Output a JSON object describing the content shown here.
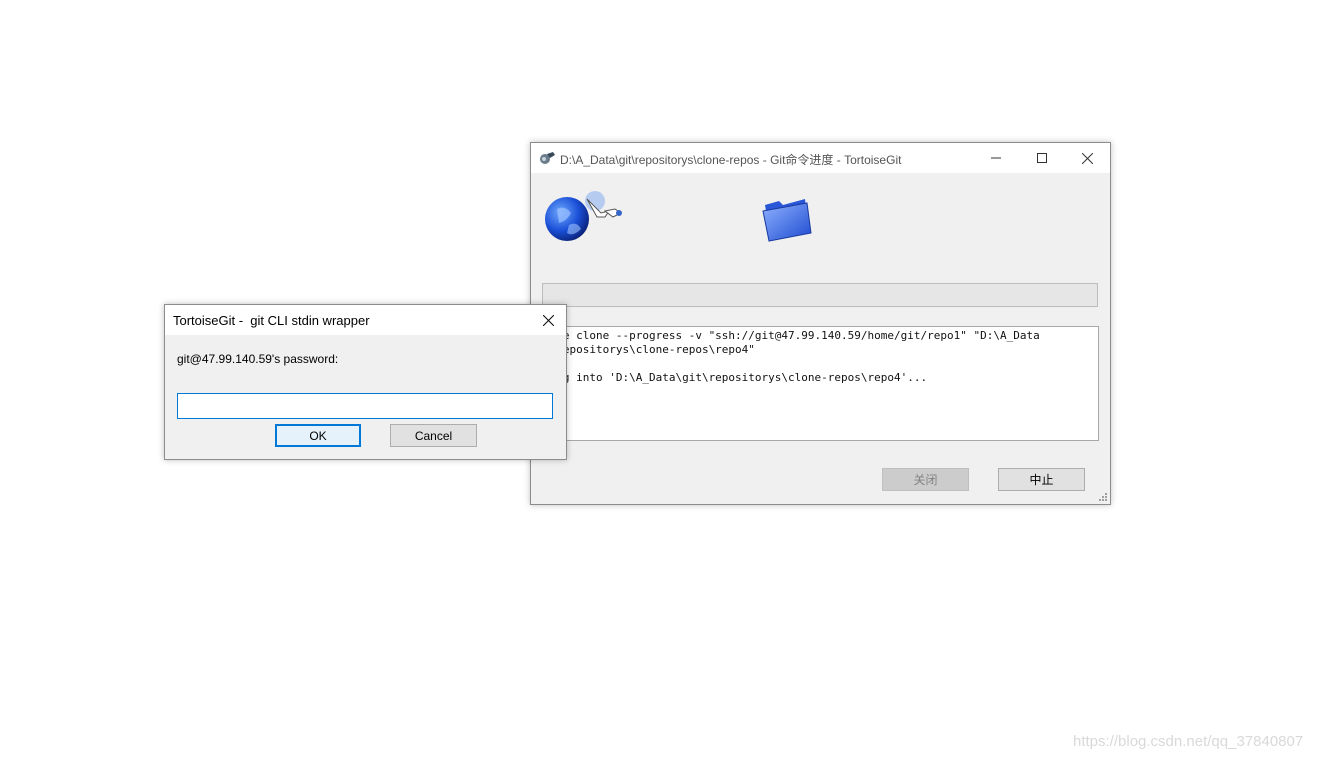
{
  "progress_window": {
    "title": "D:\\A_Data\\git\\repositorys\\clone-repos - Git命令进度 - TortoiseGit",
    "console_lines": [
      ".exe clone --progress -v \"ssh://git@47.99.140.59/home/git/repo1\" \"D:\\A_Data",
      "t\\repositorys\\clone-repos\\repo4\"",
      "",
      "ning into 'D:\\A_Data\\git\\repositorys\\clone-repos\\repo4'..."
    ],
    "close_label": "关闭",
    "abort_label": "中止",
    "progress_value": 0
  },
  "password_dialog": {
    "title": "TortoiseGit -  git CLI stdin wrapper",
    "prompt": "git@47.99.140.59's password:",
    "password_value": "",
    "ok_label": "OK",
    "cancel_label": "Cancel"
  },
  "watermark": "https://blog.csdn.net/qq_37840807",
  "colors": {
    "accent": "#0078d7",
    "window_bg": "#f0f0f0"
  },
  "icons": [
    "tortoisegit-app-icon",
    "minimize-icon",
    "maximize-icon",
    "close-icon",
    "globe-transfer-icon",
    "folder-icon",
    "resize-grip-icon"
  ]
}
